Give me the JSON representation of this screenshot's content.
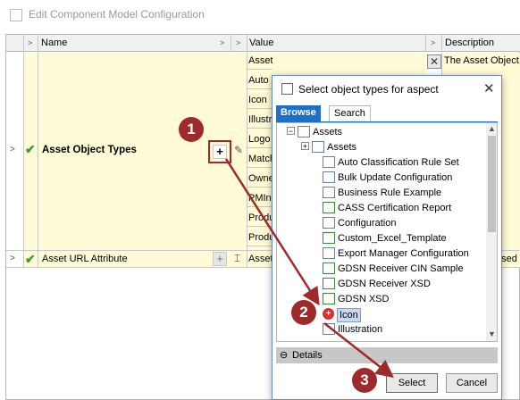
{
  "window": {
    "title": "Edit Component Model Configuration"
  },
  "grid": {
    "columns": {
      "name": "Name",
      "value": "Value",
      "description": "Description"
    },
    "rows": [
      {
        "name": "Asset Object Types",
        "values": [
          "Assets",
          "Auto",
          "Icon",
          "Illustr",
          "Logo",
          "Match",
          "Owne",
          "PMIn",
          "Produ",
          "Produ"
        ],
        "description": "The Asset Object"
      },
      {
        "name": "Asset URL Attribute",
        "value": "Asset",
        "description": "used"
      }
    ]
  },
  "dialog": {
    "title": "Select object types for aspect",
    "tabs": [
      "Browse",
      "Search"
    ],
    "tree": {
      "root": "Assets",
      "children": [
        "Assets",
        "Auto Classification Rule Set",
        "Bulk Update Configuration",
        "Business Rule Example",
        "CASS Certification Report",
        "Configuration",
        "Custom_Excel_Template",
        "Export Manager Configuration",
        "GDSN Receiver CIN Sample",
        "GDSN Receiver XSD",
        "GDSN XSD",
        "Icon",
        "Illustration"
      ]
    },
    "details_label": "Details",
    "select_label": "Select",
    "cancel_label": "Cancel"
  },
  "callouts": [
    "1",
    "2",
    "3"
  ],
  "colors": {
    "accent": "#1e6fc7",
    "callout": "#9e2a2b",
    "highlight": "#fffbd6"
  }
}
